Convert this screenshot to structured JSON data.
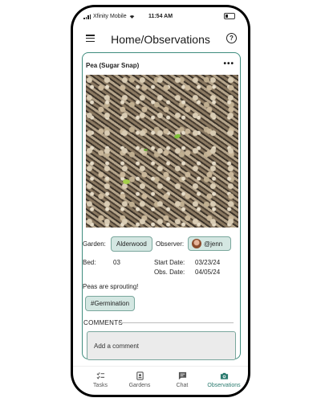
{
  "status_bar": {
    "carrier": "Xfinity Mobile",
    "time": "11:54 AM"
  },
  "header": {
    "title": "Home/Observations"
  },
  "observation": {
    "plant_name": "Pea (Sugar Snap)",
    "garden_label": "Garden:",
    "garden_value": "Alderwood",
    "observer_label": "Observer:",
    "observer_value": "@jenn",
    "bed_label": "Bed:",
    "bed_value": "03",
    "start_date_label": "Start Date:",
    "start_date_value": "03/23/24",
    "obs_date_label": "Obs. Date:",
    "obs_date_value": "04/05/24",
    "note": "Peas are sprouting!",
    "tag": "#Germination"
  },
  "comments": {
    "heading": "COMMENTS",
    "placeholder": "Add a comment"
  },
  "nav": {
    "tasks": "Tasks",
    "gardens": "Gardens",
    "chat": "Chat",
    "observations": "Observations"
  },
  "colors": {
    "accent": "#3f8c7e",
    "chip": "#d4e7e2",
    "active_nav": "#2b7b6f"
  }
}
